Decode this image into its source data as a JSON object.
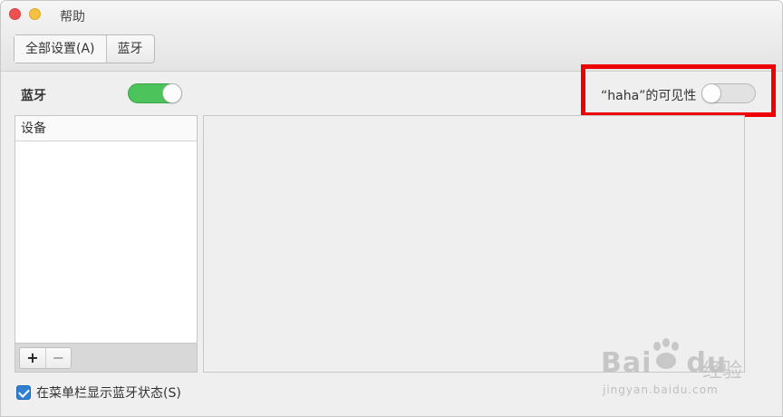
{
  "window": {
    "title": "帮助"
  },
  "tabs": [
    {
      "label": "全部设置(A)"
    },
    {
      "label": "蓝牙"
    }
  ],
  "bluetooth": {
    "label": "蓝牙",
    "enabled": true,
    "visibility_label": "“haha”的可见性",
    "visibility_enabled": false
  },
  "devices": {
    "header": "设备",
    "items": [],
    "add_label": "+",
    "remove_label": "−"
  },
  "show_in_menubar": {
    "label": "在菜单栏显示蓝牙状态(S)",
    "checked": true
  },
  "watermark": {
    "main": "Bai",
    "suffix": "du",
    "jingyan": "经验",
    "url": "jingyan.baidu.com"
  },
  "colors": {
    "switch_on": "#4cc35b",
    "highlight": "#ee0000",
    "checkbox": "#2f7fd3",
    "close": "#ee5150",
    "minimize": "#f6c040"
  }
}
